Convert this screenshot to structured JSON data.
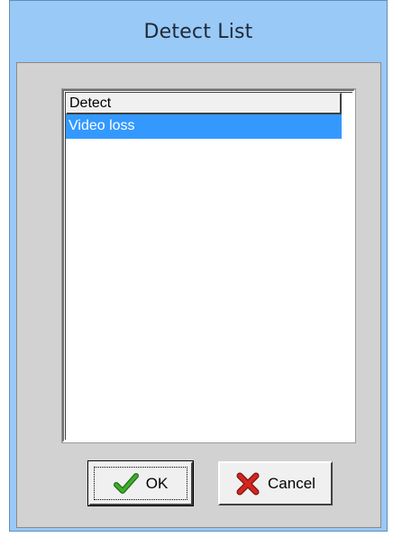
{
  "window": {
    "title": "Detect List"
  },
  "list": {
    "column_header": "Detect",
    "rows": [
      {
        "label": "Video loss",
        "selected": true
      }
    ]
  },
  "buttons": {
    "ok": {
      "label": "OK",
      "icon": "checkmark-icon"
    },
    "cancel": {
      "label": "Cancel",
      "icon": "red-x-icon"
    }
  },
  "colors": {
    "title_bar": "#99c9f7",
    "client_bg": "#d2d2d2",
    "selection": "#3399ff",
    "ok_icon": "#2e8b1f",
    "cancel_icon": "#c0201a"
  }
}
